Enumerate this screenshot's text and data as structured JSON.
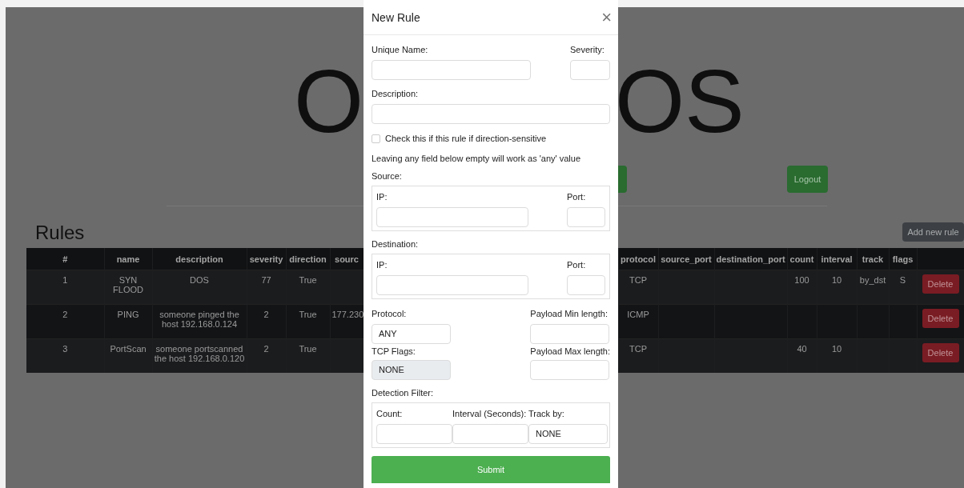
{
  "page": {
    "title_left": "O",
    "title_right": "OS",
    "logout_button": "Logout",
    "section_title": "Rules",
    "add_button": "Add new rule"
  },
  "table": {
    "columns": [
      "#",
      "name",
      "description",
      "severity",
      "direction",
      "sourc",
      "protocol",
      "source_port",
      "destination_port",
      "count",
      "interval",
      "track",
      "flags"
    ],
    "rows": [
      {
        "cells": [
          "1",
          "SYN FLOOD",
          "DOS",
          "77",
          "True",
          "",
          "TCP",
          "",
          "",
          "100",
          "10",
          "by_dst",
          "S"
        ],
        "action": "Delete"
      },
      {
        "cells": [
          "2",
          "PING",
          "someone pinged the host 192.168.0.124",
          "2",
          "True",
          "177.230",
          "ICMP",
          "",
          "",
          "",
          "",
          "",
          ""
        ],
        "action": "Delete"
      },
      {
        "cells": [
          "3",
          "PortScan",
          "someone portscanned the host 192.168.0.120",
          "2",
          "True",
          "",
          "TCP",
          "",
          "",
          "40",
          "10",
          "",
          ""
        ],
        "action": "Delete"
      }
    ]
  },
  "modal": {
    "title": "New Rule",
    "close": "×",
    "unique_name_label": "Unique Name:",
    "severity_label": "Severity:",
    "description_label": "Description:",
    "direction_sensitive": {
      "label": "Check this if this rule if direction-sensitive",
      "checked": false
    },
    "note": "Leaving any field below empty will work as 'any' value",
    "source": {
      "label": "Source:",
      "ip_label": "IP:",
      "port_label": "Port:"
    },
    "destination": {
      "label": "Destination:",
      "ip_label": "IP:",
      "port_label": "Port:"
    },
    "protocol": {
      "label": "Protocol:",
      "value": "ANY"
    },
    "payload_min_label": "Payload Min length:",
    "tcp_flags": {
      "label": "TCP Flags:",
      "value": "NONE",
      "disabled": true
    },
    "payload_max_label": "Payload Max length:",
    "detection_filter": {
      "label": "Detection Filter:",
      "count_label": "Count:",
      "interval_label": "Interval (Seconds):",
      "track_label": "Track by:",
      "track_value": "NONE"
    },
    "submit": "Submit"
  }
}
